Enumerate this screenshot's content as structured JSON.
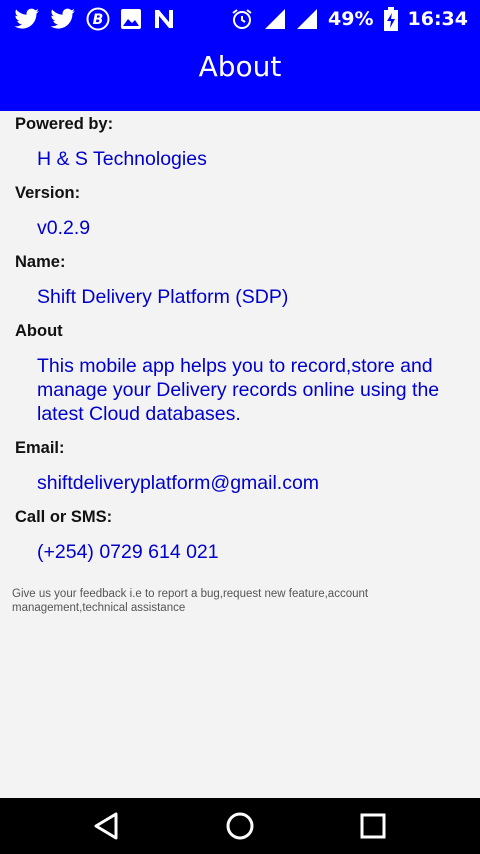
{
  "status_bar": {
    "notification_icons": [
      "twitter-icon",
      "twitter-icon",
      "bitcoin-icon",
      "image-icon",
      "n-icon"
    ],
    "battery_percent": "49%",
    "time": "16:34"
  },
  "toolbar": {
    "title": "About"
  },
  "about": {
    "powered_by_label": "Powered by:",
    "powered_by_value": "H & S Technologies",
    "version_label": "Version:",
    "version_value": "v0.2.9",
    "name_label": "Name:",
    "name_value": "Shift Delivery Platform (SDP)",
    "about_label": "About",
    "about_value": "This mobile app helps you to record,store and manage your Delivery records online using the latest Cloud databases.",
    "email_label": "Email:",
    "email_value": "shiftdeliveryplatform@gmail.com",
    "call_label": "Call or SMS:",
    "call_value": "(+254) 0729 614 021",
    "feedback_note": "Give us your feedback i.e to report a bug,request new feature,account management,technical assistance"
  },
  "colors": {
    "primary": "#0000ff",
    "value_text": "#0000cc",
    "background": "#f3f3f3"
  },
  "nav_bar": {
    "icons": [
      "back-icon",
      "home-icon",
      "recents-icon"
    ]
  }
}
